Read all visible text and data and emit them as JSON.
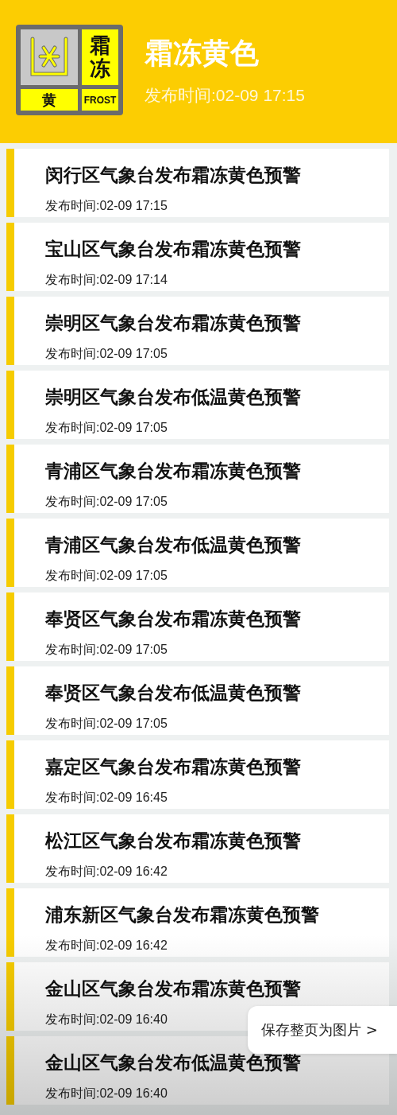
{
  "header": {
    "badge": {
      "name": "霜冻",
      "level": "黄",
      "english": "FROST"
    },
    "title": "霜冻黄色",
    "time": "发布时间:02-09 17:15"
  },
  "alerts": [
    {
      "title": "闵行区气象台发布霜冻黄色预警",
      "time": "发布时间:02-09 17:15"
    },
    {
      "title": "宝山区气象台发布霜冻黄色预警",
      "time": "发布时间:02-09 17:14"
    },
    {
      "title": "崇明区气象台发布霜冻黄色预警",
      "time": "发布时间:02-09 17:05"
    },
    {
      "title": "崇明区气象台发布低温黄色预警",
      "time": "发布时间:02-09 17:05"
    },
    {
      "title": "青浦区气象台发布霜冻黄色预警",
      "time": "发布时间:02-09 17:05"
    },
    {
      "title": "青浦区气象台发布低温黄色预警",
      "time": "发布时间:02-09 17:05"
    },
    {
      "title": "奉贤区气象台发布霜冻黄色预警",
      "time": "发布时间:02-09 17:05"
    },
    {
      "title": "奉贤区气象台发布低温黄色预警",
      "time": "发布时间:02-09 17:05"
    },
    {
      "title": "嘉定区气象台发布霜冻黄色预警",
      "time": "发布时间:02-09 16:45"
    },
    {
      "title": "松江区气象台发布霜冻黄色预警",
      "time": "发布时间:02-09 16:42"
    },
    {
      "title": "浦东新区气象台发布霜冻黄色预警",
      "time": "发布时间:02-09 16:42"
    },
    {
      "title": "金山区气象台发布霜冻黄色预警",
      "time": "发布时间:02-09 16:40"
    },
    {
      "title": "金山区气象台发布低温黄色预警",
      "time": "发布时间:02-09 16:40"
    }
  ],
  "save_button": {
    "label": "保存整页为图片 >"
  }
}
